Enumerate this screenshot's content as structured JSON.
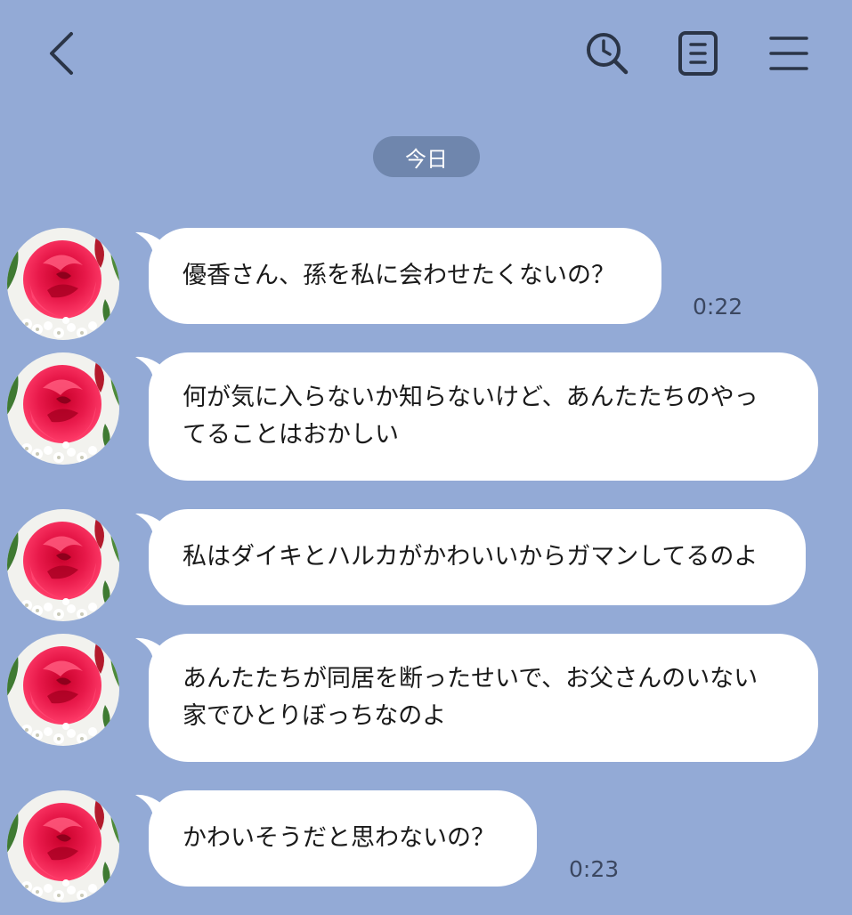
{
  "header": {
    "back_icon": "chevron-left-icon",
    "history_icon": "clock-search-icon",
    "notes_icon": "notes-icon",
    "menu_icon": "hamburger-menu-icon"
  },
  "date_separator": "今日",
  "colors": {
    "background": "#93aad6",
    "bubble": "#ffffff",
    "date_pill": "#6f86ad"
  },
  "messages": [
    {
      "text": "優香さん、孫を私に会わせたくないの？",
      "time": "0:22"
    },
    {
      "text": "何が気に入らないか知らないけど、あんたたちのやっ\nてることはおかしい",
      "time": ""
    },
    {
      "text": "私はダイキとハルカがかわいいからガマンしてるのよ",
      "time": ""
    },
    {
      "text": "あんたたちが同居を断ったせいで、お父さんのいない\n家でひとりぼっちなのよ",
      "time": ""
    },
    {
      "text": "かわいそうだと思わないの？",
      "time": "0:23"
    }
  ]
}
